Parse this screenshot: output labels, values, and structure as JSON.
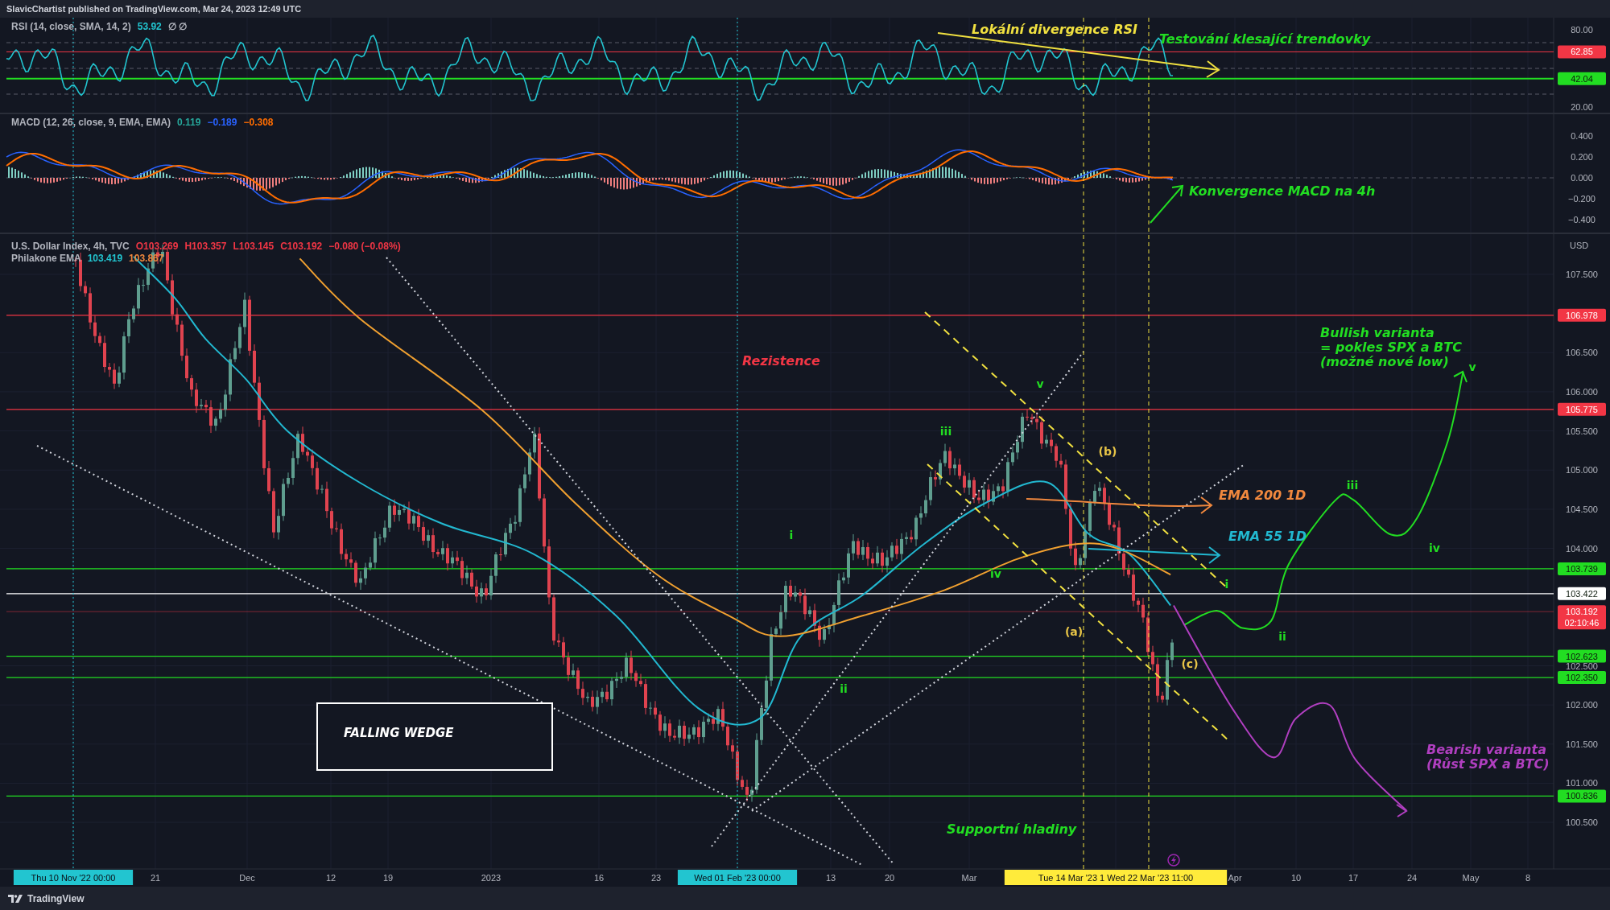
{
  "header": "SlavicChartist published on TradingView.com, Mar 24, 2023 12:49 UTC",
  "rsi": {
    "legend": [
      {
        "text": "RSI (14, close, SMA, 14, 2)",
        "color": "#b2b5be"
      },
      {
        "text": "53.92",
        "color": "#22c5d0"
      },
      {
        "text": "∅ ∅",
        "color": "#b2b5be"
      }
    ],
    "ticks": [
      "80.00",
      "20.00"
    ],
    "levels": [
      {
        "label": "62.85",
        "color": "#f23645"
      },
      {
        "label": "42.04",
        "color": "#22dd22"
      }
    ]
  },
  "macd": {
    "legend": [
      {
        "text": "MACD (12, 26, close, 9, EMA, EMA)",
        "color": "#b2b5be"
      },
      {
        "text": "0.119",
        "color": "#26a69a"
      },
      {
        "text": "−0.189",
        "color": "#2962ff"
      },
      {
        "text": "−0.308",
        "color": "#ff6d00"
      }
    ],
    "ticks": [
      "0.400",
      "0.200",
      "0.000",
      "−0.200",
      "−0.400"
    ]
  },
  "main": {
    "legend": [
      [
        {
          "text": "U.S. Dollar Index, 4h, TVC",
          "color": "#b2b5be"
        },
        {
          "text": "O103.269",
          "color": "#f23645"
        },
        {
          "text": "H103.357",
          "color": "#f23645"
        },
        {
          "text": "L103.145",
          "color": "#f23645"
        },
        {
          "text": "C103.192",
          "color": "#f23645"
        },
        {
          "text": "−0.080 (−0.08%)",
          "color": "#f23645"
        }
      ],
      [
        {
          "text": "Philakone EMA",
          "color": "#b2b5be"
        },
        {
          "text": "103.419",
          "color": "#22c5d0"
        },
        {
          "text": "103.867",
          "color": "#f0883e"
        }
      ]
    ],
    "unit": "USD",
    "ticks": [
      "107.500",
      "106.500",
      "106.000",
      "105.500",
      "105.000",
      "104.500",
      "104.000",
      "102.500",
      "102.000",
      "101.500",
      "101.000",
      "100.500"
    ],
    "levels": [
      {
        "label": "106.978",
        "color": "#f23645"
      },
      {
        "label": "105.775",
        "color": "#f23645"
      },
      {
        "label": "103.739",
        "color": "#22dd22"
      },
      {
        "label": "103.422",
        "color": "#ffffff"
      },
      {
        "label": "103.192",
        "sublabel": "02:10:46",
        "color": "#f23645"
      },
      {
        "label": "102.623",
        "color": "#22dd22"
      },
      {
        "label": "102.350",
        "color": "#22dd22"
      },
      {
        "label": "100.836",
        "color": "#22dd22"
      }
    ]
  },
  "annotations": [
    {
      "kind": "note",
      "lines": [
        "Lokální divergence RSI"
      ],
      "color": "#f0e040"
    },
    {
      "kind": "note",
      "lines": [
        "Testování klesající trendovky"
      ],
      "color": "#22dd22"
    },
    {
      "kind": "note",
      "lines": [
        "Konvergence MACD na 4h"
      ],
      "color": "#22dd22"
    },
    {
      "kind": "note",
      "lines": [
        "Rezistence"
      ],
      "color": "#f23645"
    },
    {
      "kind": "note",
      "lines": [
        "Bullish varianta",
        "= pokles SPX a BTC",
        "(možné nové low)"
      ],
      "color": "#22dd22"
    },
    {
      "kind": "wave",
      "lines": [
        "v"
      ],
      "color": "#22dd22"
    },
    {
      "kind": "wave",
      "lines": [
        "v"
      ],
      "color": "#22dd22"
    },
    {
      "kind": "wave",
      "lines": [
        "iii"
      ],
      "color": "#22dd22"
    },
    {
      "kind": "wave",
      "lines": [
        "(b)"
      ],
      "color": "#e8c547"
    },
    {
      "kind": "note",
      "lines": [
        "EMA 200 1D"
      ],
      "color": "#f0883e"
    },
    {
      "kind": "wave",
      "lines": [
        "iii"
      ],
      "color": "#22dd22"
    },
    {
      "kind": "wave",
      "lines": [
        "i"
      ],
      "color": "#22dd22"
    },
    {
      "kind": "note",
      "lines": [
        "EMA 55 1D"
      ],
      "color": "#22b8d0"
    },
    {
      "kind": "wave",
      "lines": [
        "iv"
      ],
      "color": "#22dd22"
    },
    {
      "kind": "wave",
      "lines": [
        "iv"
      ],
      "color": "#22dd22"
    },
    {
      "kind": "wave",
      "lines": [
        "i"
      ],
      "color": "#22dd22"
    },
    {
      "kind": "wave",
      "lines": [
        "(a)"
      ],
      "color": "#e8c547"
    },
    {
      "kind": "wave",
      "lines": [
        "ii"
      ],
      "color": "#22dd22"
    },
    {
      "kind": "wave",
      "lines": [
        "(c)"
      ],
      "color": "#e8c547"
    },
    {
      "kind": "wave",
      "lines": [
        "ii"
      ],
      "color": "#22dd22"
    },
    {
      "kind": "boxed",
      "lines": [
        "FALLING WEDGE"
      ],
      "color": "#ffffff"
    },
    {
      "kind": "note",
      "lines": [
        "Bearish varianta",
        "(Růst SPX a BTC)"
      ],
      "color": "#b03fc0"
    },
    {
      "kind": "note",
      "lines": [
        "Supportní hladiny"
      ],
      "color": "#22dd22"
    }
  ],
  "time_axis": [
    {
      "label": "Thu 10 Nov '22   00:00",
      "kind": "marker",
      "color": "#22c5d0"
    },
    {
      "label": "21",
      "kind": "tick"
    },
    {
      "label": "Dec",
      "kind": "tick"
    },
    {
      "label": "12",
      "kind": "tick"
    },
    {
      "label": "19",
      "kind": "tick"
    },
    {
      "label": "2023",
      "kind": "tick"
    },
    {
      "label": "16",
      "kind": "tick"
    },
    {
      "label": "23",
      "kind": "tick"
    },
    {
      "label": "Wed 01 Feb '23   00:00",
      "kind": "marker",
      "color": "#22c5d0"
    },
    {
      "label": "13",
      "kind": "tick"
    },
    {
      "label": "20",
      "kind": "tick"
    },
    {
      "label": "Mar",
      "kind": "tick"
    },
    {
      "label": "Tue 14 Mar '23   1   Wed 22 Mar '23   11:00",
      "kind": "marker",
      "color": "#ffeb3b"
    },
    {
      "label": "Apr",
      "kind": "tick"
    },
    {
      "label": "10",
      "kind": "tick"
    },
    {
      "label": "17",
      "kind": "tick"
    },
    {
      "label": "24",
      "kind": "tick"
    },
    {
      "label": "May",
      "kind": "tick"
    },
    {
      "label": "8",
      "kind": "tick"
    }
  ],
  "footer": "TradingView"
}
